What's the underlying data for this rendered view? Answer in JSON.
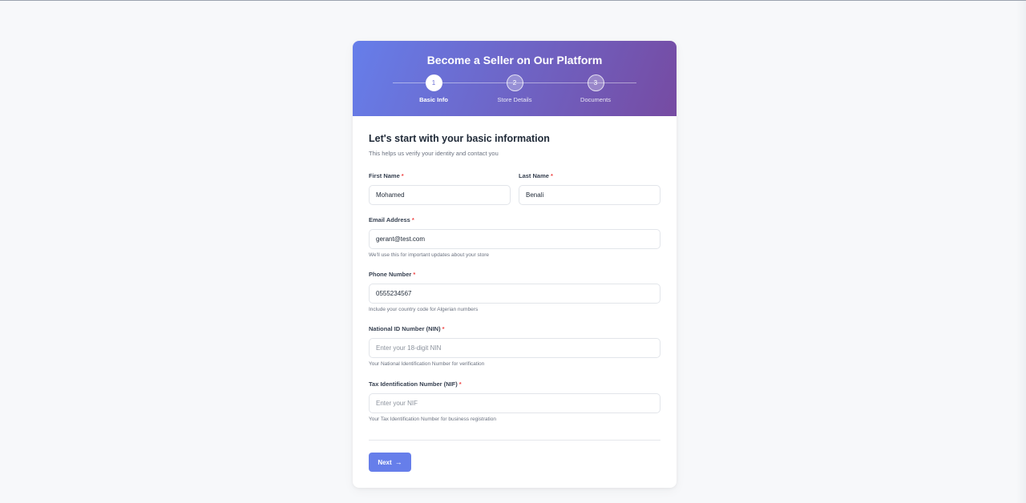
{
  "header": {
    "title": "Become a Seller on Our Platform",
    "steps": [
      {
        "number": "1",
        "label": "Basic Info",
        "active": true
      },
      {
        "number": "2",
        "label": "Store Details",
        "active": false
      },
      {
        "number": "3",
        "label": "Documents",
        "active": false
      }
    ]
  },
  "form": {
    "heading": "Let's start with your basic information",
    "subheading": "This helps us verify your identity and contact you",
    "first_name": {
      "label": "First Name",
      "required": "*",
      "value": "Mohamed"
    },
    "last_name": {
      "label": "Last Name",
      "required": "*",
      "value": "Benali"
    },
    "email": {
      "label": "Email Address",
      "required": "*",
      "value": "gerant@test.com",
      "help": "We'll use this for important updates about your store"
    },
    "phone": {
      "label": "Phone Number",
      "required": "*",
      "value": "0555234567",
      "help": "Include your country code for Algerian numbers"
    },
    "nin": {
      "label": "National ID Number (NIN)",
      "required": "*",
      "value": "",
      "placeholder": "Enter your 18-digit NIN",
      "help": "Your National Identification Number for verification"
    },
    "nif": {
      "label": "Tax Identification Number (NIF)",
      "required": "*",
      "value": "",
      "placeholder": "Enter your NIF",
      "help": "Your Tax Identification Number for business registration"
    },
    "next_label": "Next",
    "next_icon": "arrow-right-icon"
  },
  "colors": {
    "gradient_start": "#667eea",
    "gradient_end": "#764ba2",
    "required": "#ef4444",
    "button": "#667eea"
  }
}
